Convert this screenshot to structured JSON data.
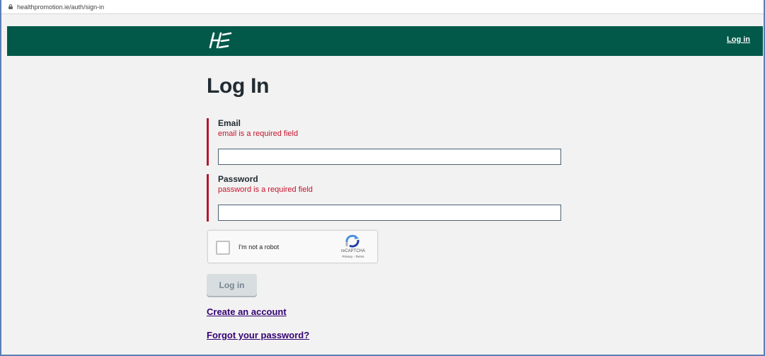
{
  "browser": {
    "url": "healthpromotion.ie/auth/sign-in"
  },
  "header": {
    "logo_icon": "hse-logo-icon",
    "login_link": "Log in",
    "background_color": "#02594a"
  },
  "main": {
    "title": "Log In",
    "fields": [
      {
        "label": "Email",
        "error": "email is a required field",
        "value": "",
        "placeholder": ""
      },
      {
        "label": "Password",
        "error": "password is a required field",
        "value": "",
        "placeholder": ""
      }
    ],
    "error_color": "#c5142c",
    "recaptcha": {
      "label": "I'm not a robot",
      "brand": "reCAPTCHA",
      "terms": "Privacy - Terms"
    },
    "submit_label": "Log in",
    "links": {
      "create_account": "Create an account",
      "forgot_password": "Forgot your password?"
    },
    "link_color": "#330072"
  }
}
